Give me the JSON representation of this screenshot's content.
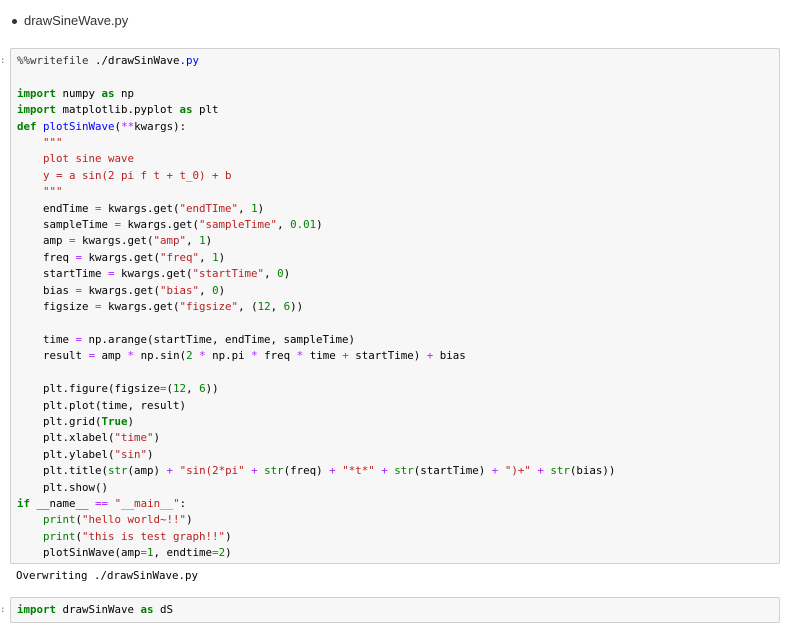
{
  "markdown": {
    "bullet_item": "drawSineWave.py"
  },
  "cell1": {
    "lines": [
      "%%writefile ./drawSinWave.py",
      "",
      "import numpy as np",
      "import matplotlib.pyplot as plt",
      "def plotSinWave(**kwargs):",
      "    \"\"\"",
      "    plot sine wave",
      "    y = a sin(2 pi f t + t_0) + b",
      "    \"\"\"",
      "    endTime = kwargs.get(\"endTIme\", 1)",
      "    sampleTime = kwargs.get(\"sampleTime\", 0.01)",
      "    amp = kwargs.get(\"amp\", 1)",
      "    freq = kwargs.get(\"freq\", 1)",
      "    startTime = kwargs.get(\"startTime\", 0)",
      "    bias = kwargs.get(\"bias\", 0)",
      "    figsize = kwargs.get(\"figsize\", (12, 6))",
      "",
      "    time = np.arange(startTime, endTime, sampleTime)",
      "    result = amp * np.sin(2 * np.pi * freq * time + startTime) + bias",
      "",
      "    plt.figure(figsize=(12, 6))",
      "    plt.plot(time, result)",
      "    plt.grid(True)",
      "    plt.xlabel(\"time\")",
      "    plt.ylabel(\"sin\")",
      "    plt.title(str(amp) + \"sin(2*pi\" + str(freq) + \"*t*\" + str(startTime) + \")+\" + str(bias))",
      "    plt.show()",
      "if __name__ == \"__main__\":",
      "    print(\"hello world~!!\")",
      "    print(\"this is test graph!!\")",
      "    plotSinWave(amp=1, endtime=2)"
    ]
  },
  "cell1_output": "Overwriting ./drawSinWave.py",
  "cell2": {
    "lines": [
      "import drawSinWave as dS"
    ]
  },
  "prompt_marks": {
    "cell1": ":",
    "cell2": ":"
  }
}
